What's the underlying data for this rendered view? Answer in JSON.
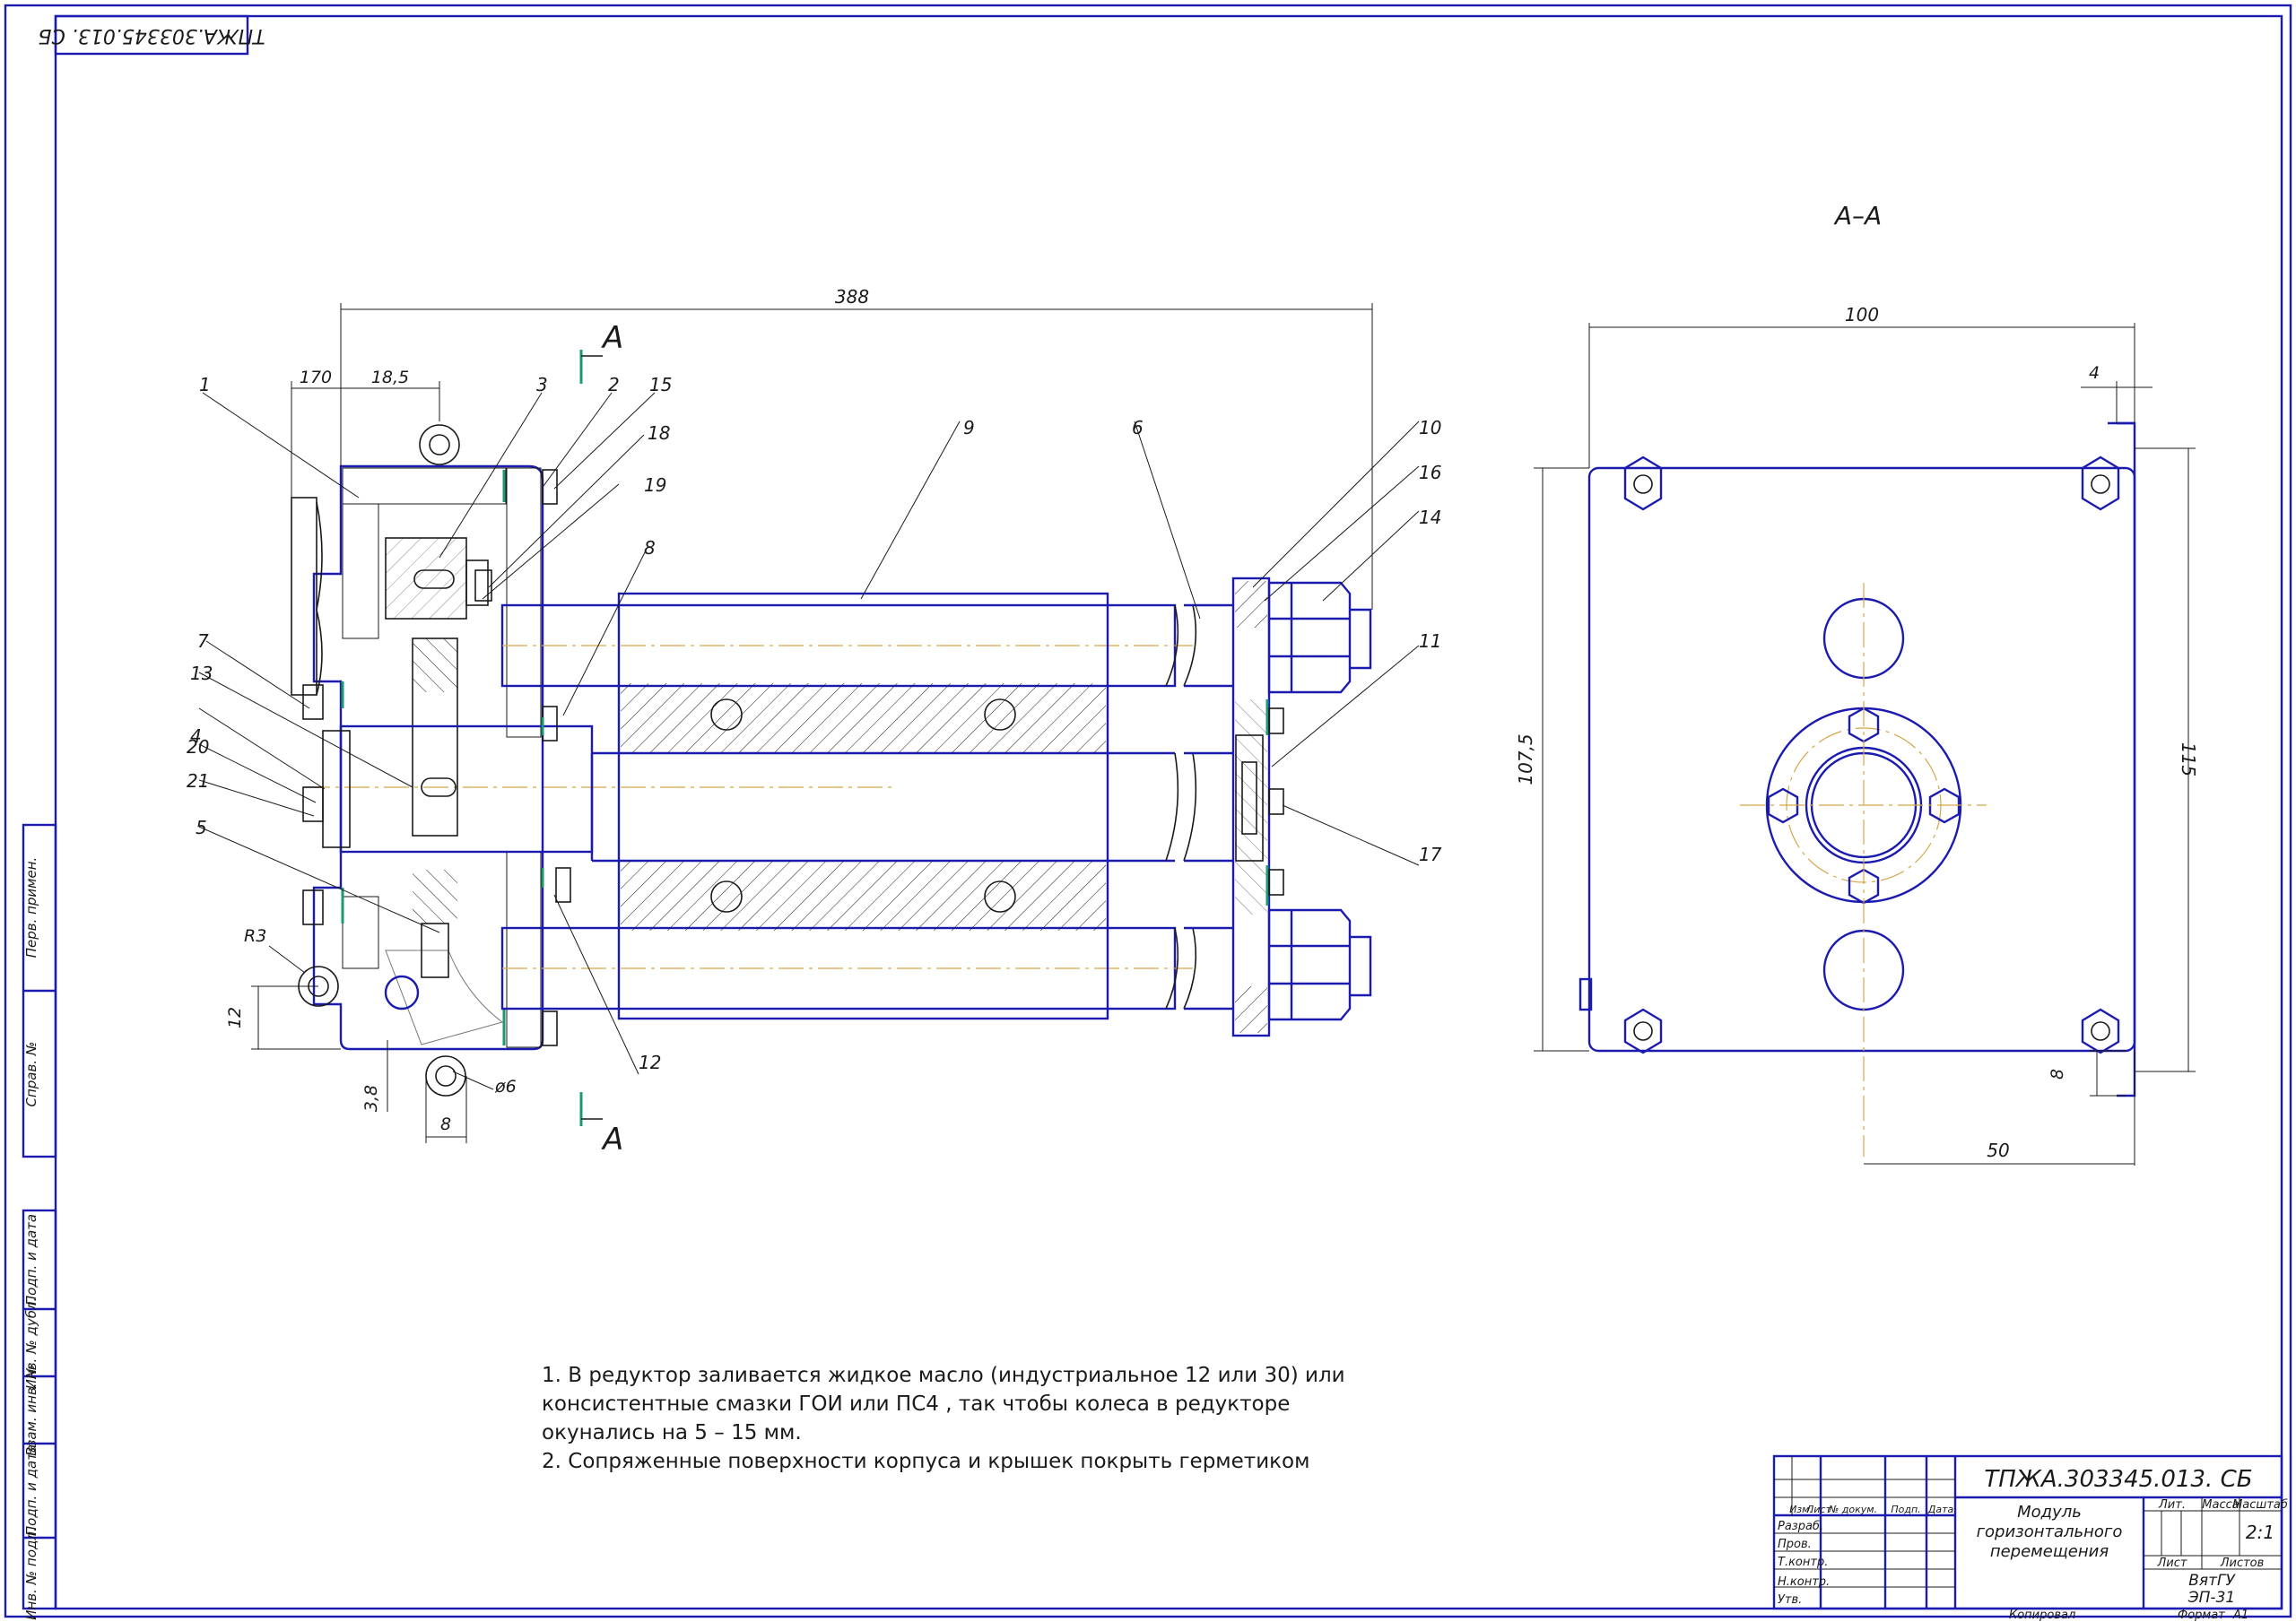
{
  "sheet": {
    "rotated_code": "ТПЖА.303345.013. СБ",
    "section_label": "А–А",
    "section_mark": "А"
  },
  "colors": {
    "outline": "#1b1bb0",
    "lines": "#1a1a1a",
    "center": "#d4a64a",
    "seal": "#1b9a6f"
  },
  "dims_main": {
    "overall": "388",
    "d170": "170",
    "d185": "18,5",
    "r3": "R3",
    "d12": "12",
    "d38": "3,8",
    "d8": "8",
    "d6": "ø6"
  },
  "dims_section": {
    "width": "100",
    "gap": "4",
    "height_left": "107,5",
    "height_right": "115",
    "offset": "50",
    "small": "8"
  },
  "callouts": [
    "1",
    "2",
    "3",
    "4",
    "5",
    "6",
    "7",
    "8",
    "9",
    "10",
    "11",
    "12",
    "13",
    "14",
    "15",
    "16",
    "17",
    "18",
    "19",
    "20",
    "21"
  ],
  "notes": [
    "1. В редуктор заливается жидкое масло (индустриальное 12 или 30) или",
    "консистентные смазки ГОИ или ПС4 , так чтобы колеса в редукторе",
    "окунались на 5 – 15 мм.",
    "2. Сопряженные поверхности корпуса и крышек покрыть герметиком"
  ],
  "side_strip": [
    "Перв. примен.",
    "Справ. №",
    "Подп. и дата",
    "Инв. № дубл.",
    "Взам. инв. №",
    "Подп. и дата",
    "Инв. № подл."
  ],
  "title_block": {
    "code": "ТПЖА.303345.013. СБ",
    "name_1": "Модуль",
    "name_2": "горизонтального",
    "name_3": "перемещения",
    "col_izm": "Изм.",
    "col_list": "Лист",
    "col_doc": "№ докум.",
    "col_podp": "Подп.",
    "col_data": "Дата",
    "row_razrab": "Разраб.",
    "row_prov": "Пров.",
    "row_tkontr": "Т.контр.",
    "row_nkontr": "Н.контр.",
    "row_utv": "Утв.",
    "lit": "Лит.",
    "massa": "Масса",
    "masshtab": "Масштаб",
    "scale_value": "2:1",
    "list": "Лист",
    "listov": "Листов",
    "org_1": "ВятГУ",
    "org_2": "ЭП-31",
    "kopiroval": "Копировал",
    "format": "Формат",
    "format_value": "А1"
  }
}
